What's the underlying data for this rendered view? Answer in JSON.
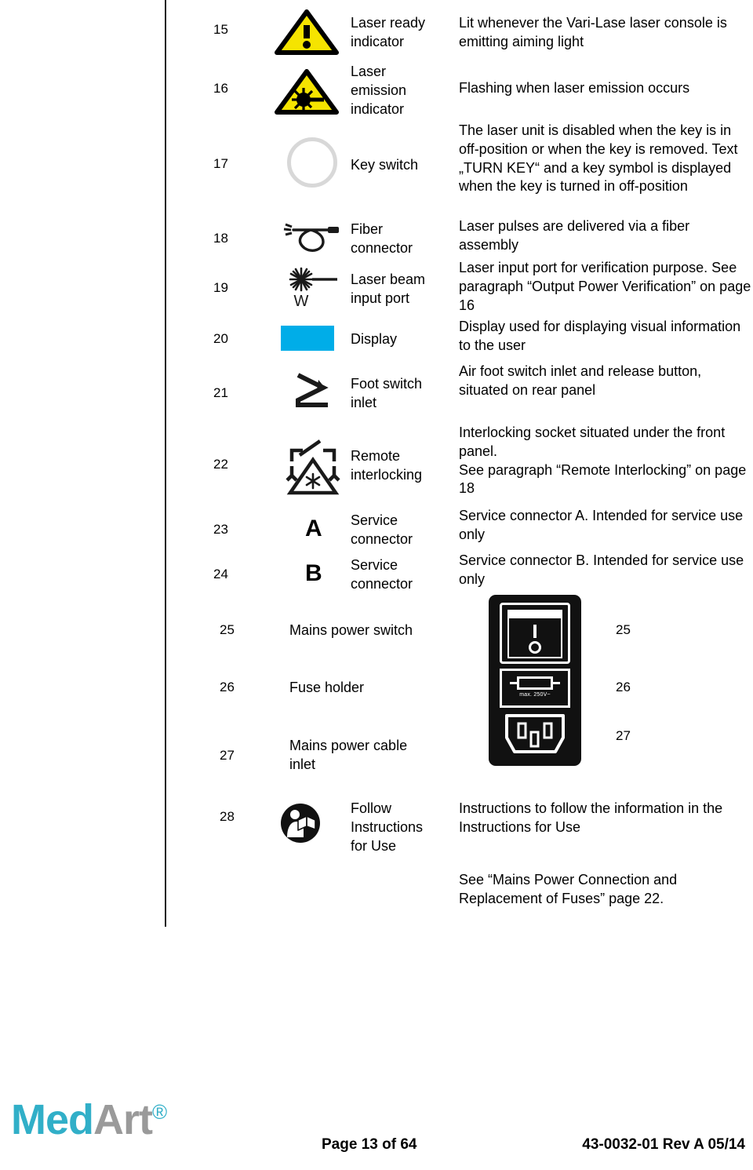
{
  "document": {
    "type": "medical-device-manual-page",
    "table_caption": "Symbol legend table (items 15-28)"
  },
  "rows": [
    {
      "num": "15",
      "icon": "warning-triangle-exclamation-icon",
      "name": "Laser ready\nindicator",
      "desc": "Lit whenever the Vari-Lase laser console is emitting aiming light"
    },
    {
      "num": "16",
      "icon": "laser-radiation-triangle-icon",
      "name": "Laser\nemission\nindicator",
      "desc": "Flashing when laser emission occurs"
    },
    {
      "num": "17",
      "icon": "key-switch-ring-icon",
      "name": "Key switch",
      "desc": "The laser unit is disabled when the key is in off-position or when the key is removed. Text „TURN KEY“ and a key symbol is displayed when the key is turned in off-position"
    },
    {
      "num": "18",
      "icon": "fiber-connector-icon",
      "name": "Fiber\nconnector",
      "desc": "Laser pulses are delivered via a fiber assembly"
    },
    {
      "num": "19",
      "icon": "laser-beam-input-port-icon",
      "icon_label": "W",
      "name": "Laser beam\ninput port",
      "desc": "Laser input port for verification purpose. See paragraph “Output Power Verification” on page 16"
    },
    {
      "num": "20",
      "icon": "display-swatch-icon",
      "name": "Display",
      "desc": "Display used for displaying visual information to the user"
    },
    {
      "num": "21",
      "icon": "foot-switch-inlet-icon",
      "name": "Foot switch\ninlet",
      "desc": "Air foot switch inlet and release button, situated on rear panel"
    },
    {
      "num": "22",
      "icon": "remote-interlocking-icon",
      "name": "Remote\ninterlocking",
      "desc": "Interlocking socket situated under the front panel.\nSee paragraph “Remote Interlocking” on page 18"
    },
    {
      "num": "23",
      "icon": "letter-a-icon",
      "icon_label": "A",
      "name": "Service\nconnector",
      "desc": "Service connector A. Intended for service use only"
    },
    {
      "num": "24",
      "icon": "letter-b-icon",
      "icon_label": "B",
      "name": "Service\nconnector",
      "desc": "Service connector B. Intended for service use only"
    }
  ],
  "power_rows": [
    {
      "num": "25",
      "name": "Mains power switch",
      "callout": "25"
    },
    {
      "num": "26",
      "name": "Fuse holder",
      "callout": "26"
    },
    {
      "num": "27",
      "name": "Mains power cable\ninlet",
      "callout": "27"
    }
  ],
  "power_module": {
    "icon": "iec-power-entry-module-icon",
    "switch_on_symbol": "I",
    "switch_off_symbol": "O",
    "fuse_rating_label": "max. 250V~"
  },
  "ifu_row": {
    "num": "28",
    "icon": "follow-instructions-for-use-icon",
    "name": "Follow\nInstructions\nfor Use",
    "desc": "Instructions to follow the information in the Instructions for Use"
  },
  "note": {
    "text": "See “Mains Power Connection and Replacement of Fuses” page 22."
  },
  "footer": {
    "logo_part1": "Med",
    "logo_part2": "Art",
    "logo_reg": "®",
    "page": "Page 13 of 64",
    "docref": "43-0032-01 Rev A 05/14"
  },
  "colors": {
    "warning_yellow": "#f5e400",
    "display_cyan": "#00ade8",
    "logo_teal": "#31afc8",
    "logo_gray": "#9a9a9a",
    "rule": "#1a1a1a"
  }
}
